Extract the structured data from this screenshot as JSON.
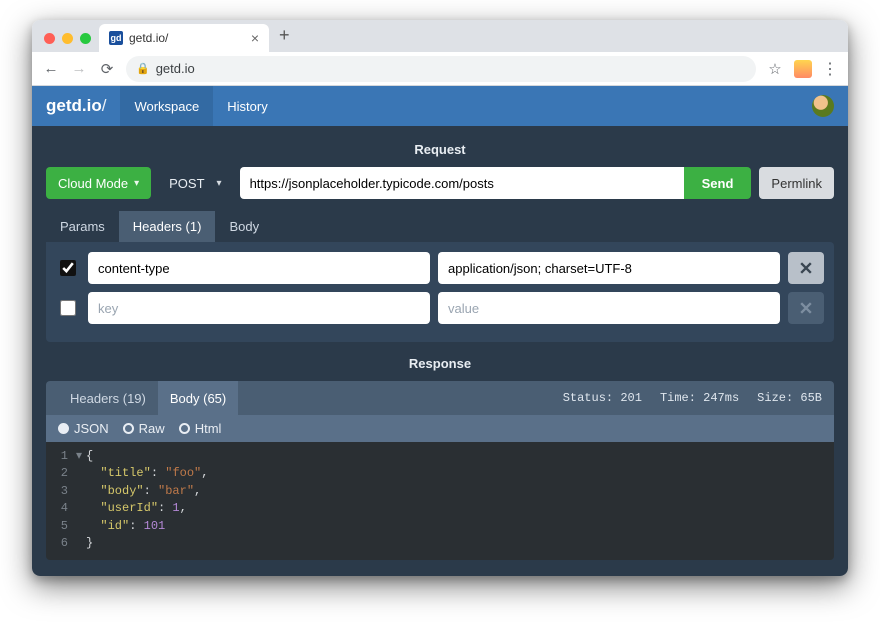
{
  "browser": {
    "tab_title": "getd.io/",
    "favicon_text": "gd",
    "url": "getd.io"
  },
  "header": {
    "brand": "getd.io",
    "brand_suffix": "/",
    "nav": {
      "workspace": "Workspace",
      "history": "History"
    }
  },
  "request": {
    "title": "Request",
    "cloud_mode": "Cloud Mode",
    "method": "POST",
    "url": "https://jsonplaceholder.typicode.com/posts",
    "send": "Send",
    "permlink": "Permlink",
    "tabs": {
      "params": "Params",
      "headers": "Headers (1)",
      "body": "Body"
    },
    "headers": {
      "row1": {
        "key": "content-type",
        "value": "application/json; charset=UTF-8"
      },
      "placeholders": {
        "key": "key",
        "value": "value"
      }
    }
  },
  "response": {
    "title": "Response",
    "tabs": {
      "headers": "Headers (19)",
      "body": "Body (65)"
    },
    "meta": {
      "status_label": "Status:",
      "status_value": "201",
      "time_label": "Time:",
      "time_value": "247ms",
      "size_label": "Size:",
      "size_value": "65B"
    },
    "formats": {
      "json": "JSON",
      "raw": "Raw",
      "html": "Html"
    },
    "body_json": {
      "title": "foo",
      "body": "bar",
      "userId": 1,
      "id": 101
    },
    "line_numbers": [
      "1",
      "2",
      "3",
      "4",
      "5",
      "6"
    ]
  }
}
